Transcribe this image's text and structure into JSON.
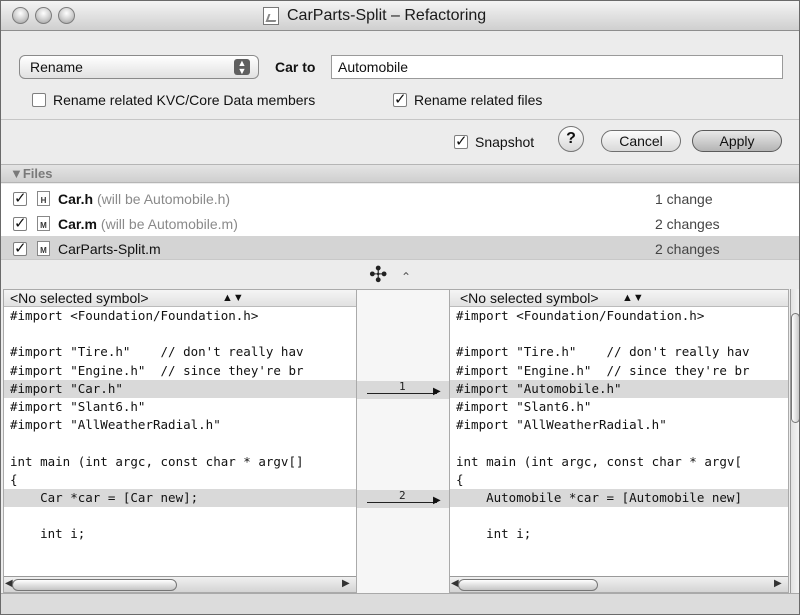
{
  "window": {
    "title": "CarParts-Split – Refactoring"
  },
  "refactor": {
    "operation": "Rename",
    "from_label": "Car to",
    "new_name": "Automobile",
    "option_kvc": "Rename related KVC/Core Data members",
    "option_files": "Rename related files",
    "option_kvc_checked": false,
    "option_files_checked": true
  },
  "actions": {
    "snapshot": "Snapshot",
    "help": "?",
    "cancel": "Cancel",
    "apply": "Apply"
  },
  "files": {
    "header": "▼Files",
    "rows": [
      {
        "name": "Car.h",
        "note": "(will be Automobile.h)",
        "changes": "1 change",
        "icon": "H",
        "checked": true,
        "selected": false
      },
      {
        "name": "Car.m",
        "note": "(will be Automobile.m)",
        "changes": "2 changes",
        "icon": "M",
        "checked": true,
        "selected": false
      },
      {
        "name": "CarParts-Split.m",
        "note": "",
        "changes": "2 changes",
        "icon": "M",
        "checked": true,
        "selected": true
      }
    ]
  },
  "diff": {
    "symbol_left": "<No selected symbol>",
    "symbol_right": "<No selected symbol>",
    "left_lines": [
      "#import <Foundation/Foundation.h>",
      "",
      "#import \"Tire.h\"    // don't really hav",
      "#import \"Engine.h\"  // since they're br",
      "#import \"Car.h\"",
      "#import \"Slant6.h\"",
      "#import \"AllWeatherRadial.h\"",
      "",
      "int main (int argc, const char * argv[]",
      "{",
      "    Car *car = [Car new];",
      "",
      "    int i;"
    ],
    "right_lines": [
      "#import <Foundation/Foundation.h>",
      "",
      "#import \"Tire.h\"    // don't really hav",
      "#import \"Engine.h\"  // since they're br",
      "#import \"Automobile.h\"",
      "#import \"Slant6.h\"",
      "#import \"AllWeatherRadial.h\"",
      "",
      "int main (int argc, const char * argv[",
      "{",
      "    Automobile *car = [Automobile new]",
      "",
      "    int i;"
    ],
    "changes": [
      {
        "number": "1"
      },
      {
        "number": "2"
      }
    ]
  }
}
